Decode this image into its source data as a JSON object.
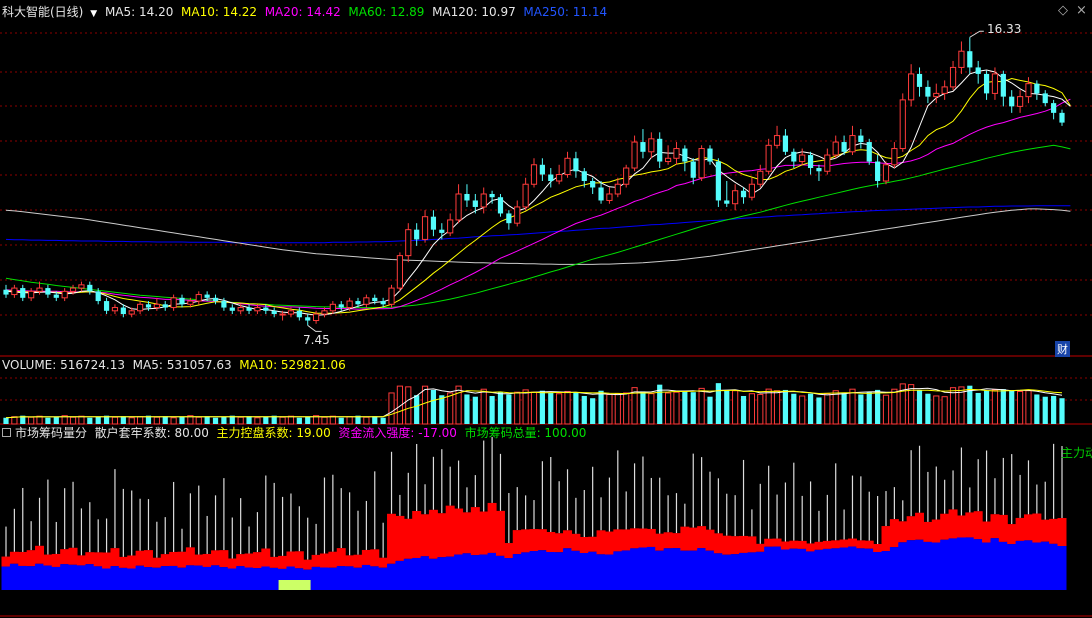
{
  "colors": {
    "up": "#ff3b3b",
    "down": "#54fcfc",
    "ma5": "#ffffff",
    "ma10": "#ffff00",
    "ma20": "#ff00ff",
    "ma60": "#00e000",
    "ma120": "#ffffff",
    "ma250": "#0000ff",
    "grid": "#8b0000",
    "sep": "#c00000",
    "chip_red": "#ff0000",
    "chip_blue": "#0000ff",
    "chip_yellow": "#ccff66",
    "chip_line": "#ffffff",
    "green_text": "#00cc00",
    "vol_ma5": "#ffffff",
    "vol_ma10": "#ffff00"
  },
  "header": {
    "title": "科大智能(日线)",
    "ma5": "MA5: 14.20",
    "ma10": "MA10: 14.22",
    "ma20": "MA20: 14.42",
    "ma60": "MA60: 12.89",
    "ma120": "MA120: 10.97",
    "ma250": "MA250: 11.14"
  },
  "price_panel": {
    "high_label": "16.33",
    "low_label": "7.45",
    "cai_badge": "财"
  },
  "volume_panel": {
    "name": "VOLUME: 516724.13",
    "ma5": "MA5: 531057.63",
    "ma10": "MA10: 529821.06"
  },
  "chip_panel": {
    "name": "市场筹码量分",
    "retail": "散户套牢系数: 80.00",
    "main": "主力控盘系数: 19.00",
    "flow": "资金流入强度: -17.00",
    "total": "市场筹码总量: 100.00",
    "right_note": "主力动"
  },
  "icons": {
    "diamond": "diamond-icon",
    "dropdown": "triangle-down-icon"
  },
  "chart_data": {
    "type": "candlestick",
    "price_range": [
      7.0,
      16.8
    ],
    "low_point": 7.45,
    "high_point": 16.33,
    "candles": [
      [
        8.55,
        8.4,
        8.7,
        8.3
      ],
      [
        8.4,
        8.6,
        8.7,
        8.3
      ],
      [
        8.6,
        8.3,
        8.7,
        8.2
      ],
      [
        8.3,
        8.5,
        8.6,
        8.2
      ],
      [
        8.5,
        8.6,
        8.8,
        8.4
      ],
      [
        8.6,
        8.4,
        8.7,
        8.3
      ],
      [
        8.4,
        8.3,
        8.5,
        8.2
      ],
      [
        8.3,
        8.5,
        8.6,
        8.2
      ],
      [
        8.5,
        8.6,
        8.7,
        8.4
      ],
      [
        8.6,
        8.7,
        8.8,
        8.5
      ],
      [
        8.7,
        8.5,
        8.8,
        8.4
      ],
      [
        8.5,
        8.2,
        8.6,
        8.1
      ],
      [
        8.2,
        7.9,
        8.3,
        7.8
      ],
      [
        7.9,
        8.0,
        8.1,
        7.8
      ],
      [
        8.0,
        7.8,
        8.1,
        7.7
      ],
      [
        7.8,
        7.9,
        8.0,
        7.7
      ],
      [
        7.9,
        8.1,
        8.2,
        7.8
      ],
      [
        8.1,
        8.0,
        8.2,
        7.9
      ],
      [
        8.0,
        8.1,
        8.3,
        7.9
      ],
      [
        8.1,
        8.0,
        8.2,
        7.9
      ],
      [
        8.0,
        8.3,
        8.4,
        7.9
      ],
      [
        8.3,
        8.1,
        8.4,
        8.0
      ],
      [
        8.1,
        8.2,
        8.3,
        8.0
      ],
      [
        8.2,
        8.4,
        8.5,
        8.1
      ],
      [
        8.4,
        8.3,
        8.5,
        8.2
      ],
      [
        8.3,
        8.2,
        8.4,
        8.1
      ],
      [
        8.2,
        8.0,
        8.3,
        7.9
      ],
      [
        8.0,
        7.9,
        8.1,
        7.8
      ],
      [
        7.9,
        8.0,
        8.1,
        7.8
      ],
      [
        8.0,
        7.9,
        8.1,
        7.8
      ],
      [
        7.9,
        8.0,
        8.1,
        7.8
      ],
      [
        8.0,
        7.9,
        8.1,
        7.8
      ],
      [
        7.9,
        7.8,
        8.0,
        7.7
      ],
      [
        7.8,
        7.8,
        7.9,
        7.6
      ],
      [
        7.8,
        7.9,
        8.0,
        7.7
      ],
      [
        7.9,
        7.7,
        8.0,
        7.6
      ],
      [
        7.7,
        7.6,
        7.8,
        7.45
      ],
      [
        7.6,
        7.8,
        7.9,
        7.5
      ],
      [
        7.8,
        7.9,
        8.0,
        7.7
      ],
      [
        7.9,
        8.1,
        8.2,
        7.8
      ],
      [
        8.1,
        8.0,
        8.2,
        7.9
      ],
      [
        8.0,
        8.2,
        8.3,
        7.9
      ],
      [
        8.2,
        8.1,
        8.3,
        8.0
      ],
      [
        8.1,
        8.3,
        8.4,
        8.0
      ],
      [
        8.3,
        8.2,
        8.4,
        8.1
      ],
      [
        8.2,
        8.1,
        8.3,
        8.0
      ],
      [
        8.1,
        8.6,
        8.7,
        8.0
      ],
      [
        8.6,
        9.6,
        9.7,
        8.5
      ],
      [
        9.6,
        10.4,
        10.6,
        9.4
      ],
      [
        10.4,
        10.1,
        10.6,
        9.9
      ],
      [
        10.1,
        10.8,
        11.0,
        10.0
      ],
      [
        10.8,
        10.4,
        11.0,
        10.2
      ],
      [
        10.4,
        10.3,
        10.6,
        10.1
      ],
      [
        10.3,
        10.7,
        10.9,
        10.2
      ],
      [
        10.7,
        11.5,
        11.8,
        10.6
      ],
      [
        11.5,
        11.3,
        11.8,
        11.1
      ],
      [
        11.3,
        11.1,
        11.5,
        10.9
      ],
      [
        11.1,
        11.5,
        11.7,
        10.9
      ],
      [
        11.5,
        11.4,
        11.6,
        11.2
      ],
      [
        11.4,
        10.9,
        11.5,
        10.8
      ],
      [
        10.9,
        10.6,
        11.0,
        10.4
      ],
      [
        10.6,
        11.1,
        11.3,
        10.5
      ],
      [
        11.1,
        11.8,
        12.0,
        11.0
      ],
      [
        11.8,
        12.4,
        12.6,
        11.7
      ],
      [
        12.4,
        12.1,
        12.6,
        11.9
      ],
      [
        12.1,
        11.9,
        12.3,
        11.7
      ],
      [
        11.9,
        12.1,
        12.4,
        11.8
      ],
      [
        12.1,
        12.6,
        12.8,
        12.0
      ],
      [
        12.6,
        12.2,
        12.8,
        12.0
      ],
      [
        12.2,
        11.9,
        12.3,
        11.7
      ],
      [
        11.9,
        11.7,
        12.0,
        11.5
      ],
      [
        11.7,
        11.3,
        11.9,
        11.2
      ],
      [
        11.3,
        11.5,
        11.7,
        11.2
      ],
      [
        11.5,
        11.8,
        12.0,
        11.4
      ],
      [
        11.8,
        12.3,
        12.4,
        11.7
      ],
      [
        12.3,
        13.1,
        13.3,
        12.2
      ],
      [
        13.1,
        12.8,
        13.5,
        12.6
      ],
      [
        12.8,
        13.2,
        13.4,
        12.6
      ],
      [
        13.2,
        12.5,
        13.4,
        12.3
      ],
      [
        12.5,
        12.6,
        13.0,
        12.4
      ],
      [
        12.6,
        12.9,
        13.1,
        12.4
      ],
      [
        12.9,
        12.5,
        13.0,
        12.2
      ],
      [
        12.5,
        12.0,
        12.6,
        11.8
      ],
      [
        12.0,
        12.9,
        13.0,
        11.9
      ],
      [
        12.9,
        12.5,
        13.0,
        12.4
      ],
      [
        12.5,
        11.3,
        12.6,
        11.1
      ],
      [
        11.3,
        11.2,
        11.9,
        11.1
      ],
      [
        11.2,
        11.6,
        11.8,
        11.0
      ],
      [
        11.6,
        11.4,
        11.7,
        11.2
      ],
      [
        11.4,
        11.8,
        12.0,
        11.3
      ],
      [
        11.8,
        12.2,
        12.4,
        11.7
      ],
      [
        12.2,
        13.0,
        13.2,
        12.1
      ],
      [
        13.0,
        13.3,
        13.6,
        12.9
      ],
      [
        13.3,
        12.8,
        13.5,
        12.7
      ],
      [
        12.8,
        12.5,
        12.9,
        12.3
      ],
      [
        12.5,
        12.7,
        12.9,
        12.4
      ],
      [
        12.7,
        12.3,
        12.8,
        12.1
      ],
      [
        12.3,
        12.2,
        12.4,
        11.9
      ],
      [
        12.2,
        12.7,
        12.9,
        12.1
      ],
      [
        12.7,
        13.1,
        13.3,
        12.6
      ],
      [
        13.1,
        12.8,
        13.3,
        12.7
      ],
      [
        12.8,
        13.3,
        13.6,
        12.7
      ],
      [
        13.3,
        13.1,
        13.5,
        12.9
      ],
      [
        13.1,
        12.5,
        13.2,
        12.4
      ],
      [
        12.5,
        11.9,
        12.7,
        11.7
      ],
      [
        11.9,
        12.4,
        12.5,
        11.8
      ],
      [
        12.4,
        12.9,
        13.1,
        12.3
      ],
      [
        12.9,
        14.4,
        14.6,
        12.8
      ],
      [
        14.4,
        15.2,
        15.5,
        14.2
      ],
      [
        15.2,
        14.8,
        15.4,
        14.5
      ],
      [
        14.8,
        14.5,
        15.0,
        14.3
      ],
      [
        14.5,
        14.6,
        14.9,
        14.3
      ],
      [
        14.6,
        14.8,
        15.0,
        14.4
      ],
      [
        14.8,
        15.4,
        15.6,
        14.7
      ],
      [
        15.4,
        15.9,
        16.2,
        15.2
      ],
      [
        15.9,
        15.4,
        16.33,
        15.2
      ],
      [
        15.4,
        15.2,
        15.6,
        14.9
      ],
      [
        15.2,
        14.6,
        15.3,
        14.4
      ],
      [
        14.6,
        15.2,
        15.4,
        14.4
      ],
      [
        15.2,
        14.5,
        15.3,
        14.2
      ],
      [
        14.5,
        14.2,
        14.7,
        14.0
      ],
      [
        14.2,
        14.5,
        14.7,
        14.0
      ],
      [
        14.5,
        14.9,
        15.1,
        14.3
      ],
      [
        14.9,
        14.6,
        15.0,
        14.4
      ],
      [
        14.6,
        14.3,
        14.7,
        14.2
      ],
      [
        14.3,
        14.0,
        14.4,
        13.8
      ],
      [
        14.0,
        13.7,
        14.1,
        13.6
      ]
    ],
    "ma5": [
      8.5,
      8.48,
      8.46,
      8.45,
      8.47,
      8.48,
      8.45,
      8.42,
      8.44,
      8.5,
      8.52,
      8.46,
      8.36,
      8.24,
      8.08,
      7.96,
      7.94,
      7.96,
      7.98,
      8.02,
      8.1,
      8.12,
      8.14,
      8.2,
      8.26,
      8.28,
      8.22,
      8.14,
      8.06,
      8.0,
      7.94,
      7.94,
      7.9,
      7.86,
      7.84,
      7.84,
      7.8,
      7.76,
      7.78,
      7.82,
      7.88,
      7.96,
      8.04,
      8.12,
      8.16,
      8.18,
      8.26,
      8.52,
      8.88,
      9.2,
      9.56,
      9.94,
      10.2,
      10.38,
      10.64,
      10.84,
      10.98,
      11.08,
      11.3,
      11.36,
      11.14,
      10.98,
      11.06,
      11.3,
      11.58,
      11.88,
      12.06,
      12.2,
      12.26,
      12.14,
      12.04,
      11.84,
      11.72,
      11.7,
      11.86,
      12.12,
      12.3,
      12.62,
      12.78,
      12.76,
      12.76,
      12.66,
      12.56,
      12.54,
      12.58,
      12.24,
      12.04,
      11.86,
      11.7,
      11.5,
      11.66,
      12.0,
      12.36,
      12.62,
      12.74,
      12.8,
      12.76,
      12.66,
      12.54,
      12.6,
      12.76,
      12.98,
      13.06,
      13.02,
      12.78,
      12.44,
      12.3,
      12.48,
      12.94,
      13.58,
      14.22,
      14.46,
      14.6,
      14.66,
      14.92,
      15.2,
      15.28,
      15.32,
      15.26,
      15.06,
      14.92,
      14.74,
      14.6,
      14.58,
      14.54,
      14.5,
      14.42,
      14.2
    ],
    "ma10": [
      8.52,
      8.5,
      8.49,
      8.48,
      8.48,
      8.48,
      8.47,
      8.45,
      8.45,
      8.47,
      8.49,
      8.47,
      8.41,
      8.34,
      8.28,
      8.24,
      8.2,
      8.16,
      8.11,
      8.05,
      8.02,
      8.02,
      8.03,
      8.08,
      8.13,
      8.18,
      8.17,
      8.15,
      8.14,
      8.12,
      8.11,
      8.09,
      8.03,
      7.99,
      7.95,
      7.92,
      7.87,
      7.83,
      7.82,
      7.83,
      7.84,
      7.86,
      7.9,
      7.94,
      7.98,
      8.02,
      8.1,
      8.24,
      8.44,
      8.64,
      8.84,
      9.06,
      9.25,
      9.46,
      9.67,
      9.88,
      10.07,
      10.27,
      10.47,
      10.65,
      10.76,
      10.86,
      10.97,
      11.12,
      11.25,
      11.4,
      11.5,
      11.61,
      11.72,
      11.78,
      11.84,
      11.84,
      11.87,
      11.95,
      12.0,
      12.08,
      12.12,
      12.18,
      12.22,
      12.28,
      12.42,
      12.46,
      12.54,
      12.64,
      12.58,
      12.52,
      12.4,
      12.22,
      12.1,
      12.02,
      11.94,
      11.95,
      12.05,
      12.2,
      12.28,
      12.4,
      12.48,
      12.52,
      12.56,
      12.67,
      12.76,
      12.83,
      12.86,
      12.84,
      12.72,
      12.62,
      12.58,
      12.66,
      12.84,
      13.0,
      13.3,
      13.48,
      13.58,
      13.74,
      14.06,
      14.45,
      14.76,
      14.94,
      14.97,
      14.96,
      15.06,
      15.0,
      14.95,
      14.88,
      14.84,
      14.75,
      14.62,
      14.22
    ],
    "ma20": [
      8.55,
      8.53,
      8.52,
      8.51,
      8.5,
      8.5,
      8.5,
      8.49,
      8.48,
      8.48,
      8.48,
      8.47,
      8.45,
      8.41,
      8.38,
      8.35,
      8.32,
      8.3,
      8.28,
      8.25,
      8.25,
      8.24,
      8.22,
      8.21,
      8.2,
      8.19,
      8.17,
      8.15,
      8.12,
      8.09,
      8.06,
      8.04,
      8.03,
      8.02,
      8.02,
      8.01,
      8.0,
      7.98,
      7.97,
      7.97,
      7.97,
      7.96,
      7.95,
      7.96,
      7.96,
      7.96,
      7.97,
      8.03,
      8.12,
      8.22,
      8.33,
      8.45,
      8.57,
      8.7,
      8.82,
      8.95,
      9.08,
      9.22,
      9.37,
      9.52,
      9.63,
      9.74,
      9.86,
      9.98,
      10.1,
      10.23,
      10.35,
      10.47,
      10.59,
      10.68,
      10.77,
      10.85,
      10.95,
      11.06,
      11.15,
      11.27,
      11.35,
      11.46,
      11.55,
      11.63,
      11.76,
      11.82,
      11.9,
      11.98,
      12.04,
      12.1,
      12.14,
      12.17,
      12.2,
      12.22,
      12.26,
      12.28,
      12.33,
      12.38,
      12.38,
      12.4,
      12.38,
      12.37,
      12.36,
      12.4,
      12.44,
      12.46,
      12.48,
      12.48,
      12.46,
      12.44,
      12.44,
      12.47,
      12.52,
      12.6,
      12.72,
      12.88,
      12.98,
      13.06,
      13.2,
      13.34,
      13.46,
      13.56,
      13.64,
      13.7,
      13.78,
      13.86,
      13.92,
      13.98,
      14.05,
      14.15,
      14.3,
      14.42
    ],
    "ma60": [
      8.9,
      8.86,
      8.82,
      8.78,
      8.75,
      8.72,
      8.68,
      8.65,
      8.62,
      8.59,
      8.56,
      8.53,
      8.5,
      8.47,
      8.44,
      8.41,
      8.38,
      8.36,
      8.34,
      8.32,
      8.3,
      8.28,
      8.26,
      8.24,
      8.22,
      8.2,
      8.18,
      8.16,
      8.14,
      8.12,
      8.11,
      8.1,
      8.08,
      8.07,
      8.06,
      8.05,
      8.04,
      8.03,
      8.02,
      8.02,
      8.01,
      8.0,
      8.0,
      8.0,
      8.0,
      8.0,
      8.01,
      8.03,
      8.05,
      8.08,
      8.12,
      8.16,
      8.21,
      8.26,
      8.32,
      8.38,
      8.44,
      8.51,
      8.58,
      8.65,
      8.72,
      8.79,
      8.86,
      8.94,
      9.02,
      9.1,
      9.17,
      9.25,
      9.33,
      9.41,
      9.49,
      9.56,
      9.63,
      9.7,
      9.78,
      9.86,
      9.94,
      10.02,
      10.1,
      10.18,
      10.26,
      10.34,
      10.42,
      10.5,
      10.57,
      10.64,
      10.7,
      10.76,
      10.82,
      10.88,
      10.94,
      11.01,
      11.08,
      11.15,
      11.22,
      11.28,
      11.34,
      11.4,
      11.46,
      11.52,
      11.58,
      11.64,
      11.7,
      11.75,
      11.8,
      11.84,
      11.89,
      11.94,
      12.0,
      12.06,
      12.13,
      12.2,
      12.27,
      12.33,
      12.4,
      12.46,
      12.53,
      12.6,
      12.66,
      12.72,
      12.78,
      12.83,
      12.88,
      12.92,
      12.96,
      13.0,
      12.95,
      12.89
    ],
    "ma120": [
      11.0,
      10.98,
      10.95,
      10.92,
      10.89,
      10.86,
      10.83,
      10.8,
      10.77,
      10.74,
      10.7,
      10.66,
      10.62,
      10.58,
      10.54,
      10.5,
      10.46,
      10.42,
      10.38,
      10.34,
      10.3,
      10.26,
      10.22,
      10.18,
      10.14,
      10.1,
      10.06,
      10.02,
      9.98,
      9.94,
      9.9,
      9.86,
      9.82,
      9.78,
      9.75,
      9.72,
      9.69,
      9.66,
      9.64,
      9.62,
      9.6,
      9.58,
      9.56,
      9.54,
      9.52,
      9.5,
      9.48,
      9.47,
      9.46,
      9.45,
      9.44,
      9.43,
      9.42,
      9.41,
      9.4,
      9.39,
      9.38,
      9.38,
      9.37,
      9.37,
      9.36,
      9.36,
      9.35,
      9.35,
      9.34,
      9.34,
      9.33,
      9.33,
      9.33,
      9.33,
      9.33,
      9.34,
      9.34,
      9.35,
      9.36,
      9.37,
      9.38,
      9.4,
      9.42,
      9.44,
      9.46,
      9.49,
      9.52,
      9.55,
      9.58,
      9.62,
      9.66,
      9.7,
      9.74,
      9.78,
      9.82,
      9.86,
      9.9,
      9.94,
      9.98,
      10.02,
      10.06,
      10.1,
      10.14,
      10.18,
      10.22,
      10.26,
      10.3,
      10.34,
      10.38,
      10.42,
      10.46,
      10.5,
      10.54,
      10.58,
      10.62,
      10.66,
      10.7,
      10.74,
      10.78,
      10.82,
      10.86,
      10.9,
      10.94,
      10.97,
      11.0,
      11.02,
      11.04,
      11.04,
      11.03,
      11.02,
      11.0,
      10.97
    ],
    "ma250": [
      10.1,
      10.09,
      10.09,
      10.08,
      10.08,
      10.07,
      10.07,
      10.06,
      10.06,
      10.05,
      10.05,
      10.05,
      10.04,
      10.04,
      10.04,
      10.03,
      10.03,
      10.03,
      10.02,
      10.02,
      10.02,
      10.02,
      10.01,
      10.01,
      10.01,
      10.01,
      10.01,
      10.0,
      10.0,
      10.0,
      10.0,
      10.0,
      10.0,
      10.0,
      10.0,
      10.0,
      10.0,
      10.0,
      10.0,
      10.01,
      10.01,
      10.01,
      10.02,
      10.02,
      10.03,
      10.03,
      10.04,
      10.05,
      10.06,
      10.07,
      10.08,
      10.1,
      10.11,
      10.13,
      10.14,
      10.16,
      10.18,
      10.19,
      10.21,
      10.22,
      10.24,
      10.25,
      10.27,
      10.29,
      10.31,
      10.33,
      10.35,
      10.36,
      10.38,
      10.4,
      10.42,
      10.44,
      10.45,
      10.47,
      10.49,
      10.51,
      10.53,
      10.55,
      10.56,
      10.58,
      10.6,
      10.62,
      10.64,
      10.66,
      10.68,
      10.69,
      10.71,
      10.73,
      10.75,
      10.77,
      10.78,
      10.8,
      10.82,
      10.83,
      10.85,
      10.86,
      10.88,
      10.89,
      10.91,
      10.92,
      10.94,
      10.95,
      10.96,
      10.98,
      10.99,
      11.0,
      11.01,
      11.02,
      11.03,
      11.04,
      11.05,
      11.06,
      11.07,
      11.08,
      11.09,
      11.1,
      11.1,
      11.11,
      11.12,
      11.12,
      11.13,
      11.13,
      11.13,
      11.14,
      11.14,
      11.14,
      11.14,
      11.14
    ]
  }
}
